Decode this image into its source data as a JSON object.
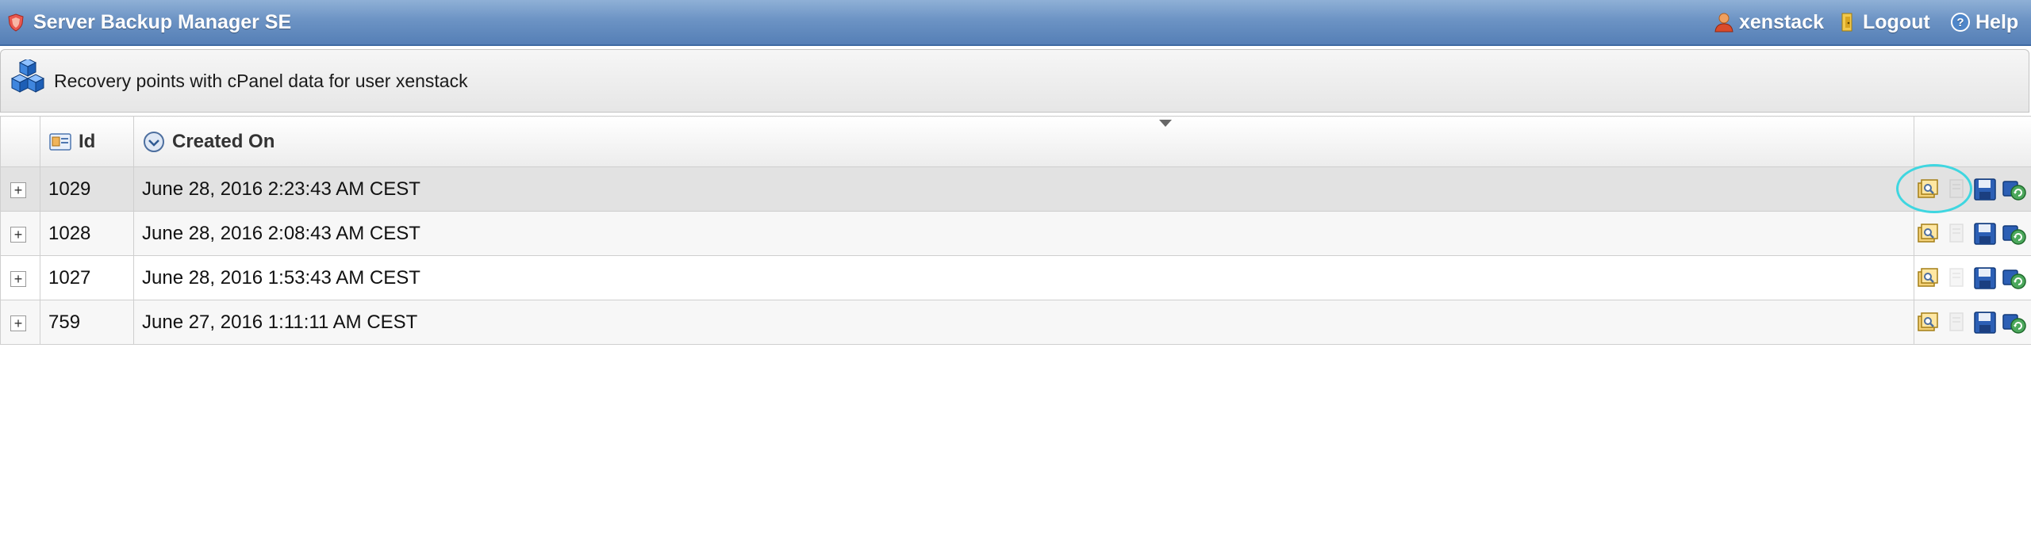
{
  "app": {
    "title": "Server Backup Manager SE"
  },
  "topbar": {
    "user": "xenstack",
    "logout": "Logout",
    "help": "Help"
  },
  "panel": {
    "title": "Recovery points with cPanel data for user xenstack"
  },
  "table": {
    "columns": {
      "id": "Id",
      "created_on": "Created On"
    },
    "rows": [
      {
        "expand": "+",
        "id": "1029",
        "created_on": "June 28, 2016 2:23:43 AM CEST"
      },
      {
        "expand": "+",
        "id": "1028",
        "created_on": "June 28, 2016 2:08:43 AM CEST"
      },
      {
        "expand": "+",
        "id": "1027",
        "created_on": "June 28, 2016 1:53:43 AM CEST"
      },
      {
        "expand": "+",
        "id": "759",
        "created_on": "June 27, 2016 1:11:11 AM CEST"
      }
    ],
    "row_actions": [
      "browse-icon",
      "delete-icon",
      "save-icon",
      "restore-icon"
    ]
  },
  "colors": {
    "topbar": "#6c93c4",
    "highlight_ring": "#3fd6e0"
  }
}
